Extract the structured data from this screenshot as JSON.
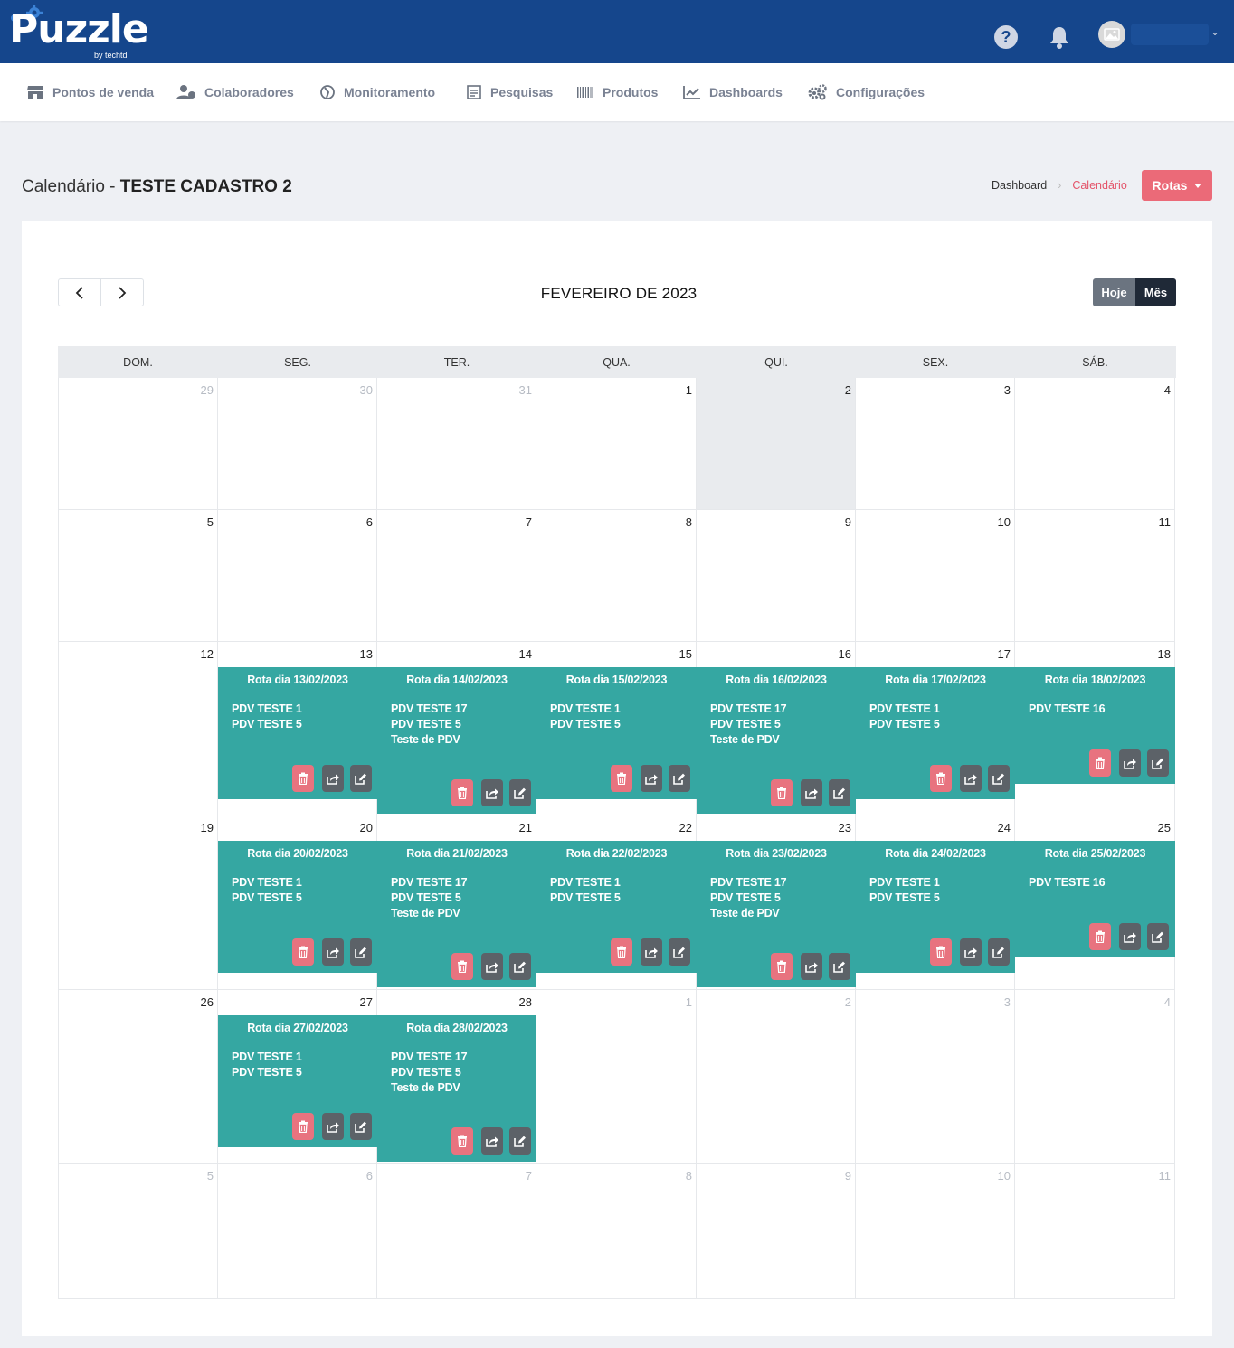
{
  "brand": {
    "name": "Puzzle",
    "tagline": "by techtd"
  },
  "nav": [
    {
      "label": "Pontos de venda",
      "icon": "store-icon"
    },
    {
      "label": "Colaboradores",
      "icon": "users-icon"
    },
    {
      "label": "Monitoramento",
      "icon": "monitor-icon"
    },
    {
      "label": "Pesquisas",
      "icon": "survey-icon"
    },
    {
      "label": "Produtos",
      "icon": "barcode-icon"
    },
    {
      "label": "Dashboards",
      "icon": "chart-line-icon"
    },
    {
      "label": "Configurações",
      "icon": "gears-icon"
    }
  ],
  "page": {
    "title_prefix": "Calendário - ",
    "title_bold": "TESTE CADASTRO 2",
    "breadcrumb": {
      "home": "Dashboard",
      "current": "Calendário"
    },
    "rotas_button": "Rotas"
  },
  "calendar": {
    "month_title": "FEVEREIRO DE 2023",
    "today_label": "Hoje",
    "month_label": "Mês",
    "weekdays": [
      "DOM.",
      "SEG.",
      "TER.",
      "QUA.",
      "QUI.",
      "SEX.",
      "SÁB."
    ],
    "today_date": "02/02/2023",
    "weeks": [
      [
        {
          "d": "29",
          "m": true
        },
        {
          "d": "30",
          "m": true
        },
        {
          "d": "31",
          "m": true
        },
        {
          "d": "1"
        },
        {
          "d": "2",
          "today": true
        },
        {
          "d": "3"
        },
        {
          "d": "4"
        }
      ],
      [
        {
          "d": "5"
        },
        {
          "d": "6"
        },
        {
          "d": "7"
        },
        {
          "d": "8"
        },
        {
          "d": "9"
        },
        {
          "d": "10"
        },
        {
          "d": "11"
        }
      ],
      [
        {
          "d": "12"
        },
        {
          "d": "13"
        },
        {
          "d": "14"
        },
        {
          "d": "15"
        },
        {
          "d": "16"
        },
        {
          "d": "17"
        },
        {
          "d": "18"
        }
      ],
      [
        {
          "d": "19"
        },
        {
          "d": "20"
        },
        {
          "d": "21"
        },
        {
          "d": "22"
        },
        {
          "d": "23"
        },
        {
          "d": "24"
        },
        {
          "d": "25"
        }
      ],
      [
        {
          "d": "26"
        },
        {
          "d": "27"
        },
        {
          "d": "28"
        },
        {
          "d": "1",
          "m": true
        },
        {
          "d": "2",
          "m": true
        },
        {
          "d": "3",
          "m": true
        },
        {
          "d": "4",
          "m": true
        }
      ],
      [
        {
          "d": "5",
          "m": true
        },
        {
          "d": "6",
          "m": true
        },
        {
          "d": "7",
          "m": true
        },
        {
          "d": "8",
          "m": true
        },
        {
          "d": "9",
          "m": true
        },
        {
          "d": "10",
          "m": true
        },
        {
          "d": "11",
          "m": true
        }
      ]
    ],
    "events": [
      {
        "week": 2,
        "day": 1,
        "title": "Rota dia 13/02/2023",
        "items": [
          "PDV TESTE 1",
          "PDV TESTE 5"
        ]
      },
      {
        "week": 2,
        "day": 2,
        "title": "Rota dia 14/02/2023",
        "items": [
          "PDV TESTE 17",
          "PDV TESTE 5",
          "Teste de PDV"
        ]
      },
      {
        "week": 2,
        "day": 3,
        "title": "Rota dia 15/02/2023",
        "items": [
          "PDV TESTE 1",
          "PDV TESTE 5"
        ]
      },
      {
        "week": 2,
        "day": 4,
        "title": "Rota dia 16/02/2023",
        "items": [
          "PDV TESTE 17",
          "PDV TESTE 5",
          "Teste de PDV"
        ]
      },
      {
        "week": 2,
        "day": 5,
        "title": "Rota dia 17/02/2023",
        "items": [
          "PDV TESTE 1",
          "PDV TESTE 5"
        ]
      },
      {
        "week": 2,
        "day": 6,
        "title": "Rota dia 18/02/2023",
        "items": [
          "PDV TESTE 16"
        ]
      },
      {
        "week": 3,
        "day": 1,
        "title": "Rota dia 20/02/2023",
        "items": [
          "PDV TESTE 1",
          "PDV TESTE 5"
        ]
      },
      {
        "week": 3,
        "day": 2,
        "title": "Rota dia 21/02/2023",
        "items": [
          "PDV TESTE 17",
          "PDV TESTE 5",
          "Teste de PDV"
        ]
      },
      {
        "week": 3,
        "day": 3,
        "title": "Rota dia 22/02/2023",
        "items": [
          "PDV TESTE 1",
          "PDV TESTE 5"
        ]
      },
      {
        "week": 3,
        "day": 4,
        "title": "Rota dia 23/02/2023",
        "items": [
          "PDV TESTE 17",
          "PDV TESTE 5",
          "Teste de PDV"
        ]
      },
      {
        "week": 3,
        "day": 5,
        "title": "Rota dia 24/02/2023",
        "items": [
          "PDV TESTE 1",
          "PDV TESTE 5"
        ]
      },
      {
        "week": 3,
        "day": 6,
        "title": "Rota dia 25/02/2023",
        "items": [
          "PDV TESTE 16"
        ]
      },
      {
        "week": 4,
        "day": 1,
        "title": "Rota dia 27/02/2023",
        "items": [
          "PDV TESTE 1",
          "PDV TESTE 5"
        ]
      },
      {
        "week": 4,
        "day": 2,
        "title": "Rota dia 28/02/2023",
        "items": [
          "PDV TESTE 17",
          "PDV TESTE 5",
          "Teste de PDV"
        ]
      }
    ]
  },
  "colors": {
    "topbar": "#15468c",
    "event": "#35a7a2",
    "danger": "#eb6a78",
    "dark": "#1f2937"
  }
}
